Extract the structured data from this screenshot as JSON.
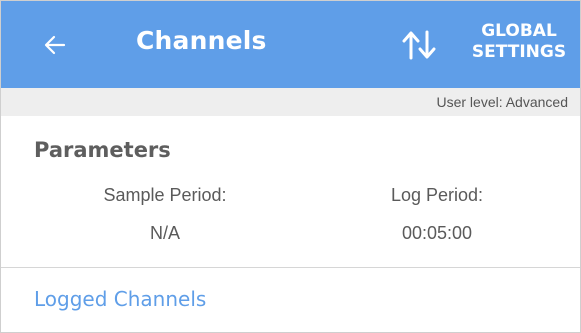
{
  "app_bar": {
    "title": "Channels",
    "back_icon": "arrow-left-icon",
    "sort_icon": "swap-vertical-icon",
    "global_settings_line1": "GLOBAL",
    "global_settings_line2": "SETTINGS",
    "background_color": "#5f9ee8"
  },
  "user_level": {
    "text": "User level: Advanced"
  },
  "parameters": {
    "title": "Parameters",
    "sample_period_label": "Sample Period:",
    "sample_period_value": "N/A",
    "log_period_label": "Log Period:",
    "log_period_value": "00:05:00"
  },
  "logged_channels": {
    "title": "Logged Channels",
    "accent_color": "#5f9ee8"
  }
}
